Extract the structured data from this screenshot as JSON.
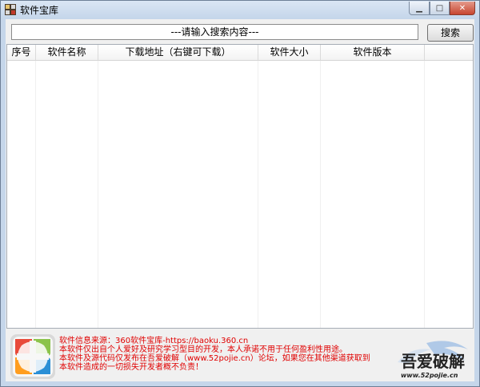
{
  "window": {
    "title": "软件宝库"
  },
  "search": {
    "placeholder": "---请输入搜索内容---",
    "button_label": "搜索"
  },
  "table": {
    "columns": [
      "序号",
      "软件名称",
      "下载地址（右键可下载）",
      "软件大小",
      "软件版本"
    ],
    "rows": []
  },
  "footer": {
    "lines": [
      "软件信息来源：360软件宝库-https://baoku.360.cn",
      "本软件仅出自个人爱好及研究学习型目的开发，本人承诺不用于任何盈利性用途。",
      "本软件及源代码仅发布在吾爱破解（www.52pojie.cn）论坛，如果您在其他渠道获取到",
      "本软件造成的一切损失开发者概不负责！"
    ],
    "brand_logo_text": "吾爱破解",
    "brand_url_text": "www.52pojie.cn"
  },
  "colors": {
    "notice_text": "#e00000",
    "window_frame": "#c5d6ea"
  }
}
